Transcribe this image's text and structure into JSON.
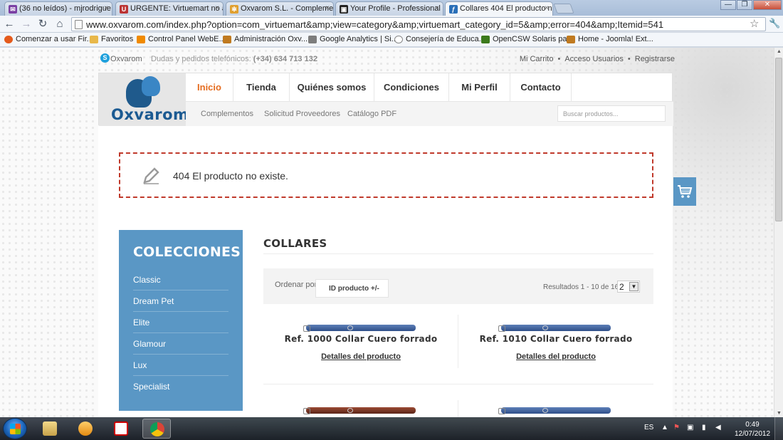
{
  "browser": {
    "tabs": [
      {
        "label": "(36 no leídos) - mjrodrigue",
        "favicon_color": "#7a3fa3",
        "favicon_char": "✉"
      },
      {
        "label": "URGENTE: Virtuemart no a",
        "favicon_color": "#b33",
        "favicon_char": "U"
      },
      {
        "label": "Oxvarom S.L. - Compleme",
        "favicon_color": "#e0a030",
        "favicon_char": "✻"
      },
      {
        "label": "Your Profile - Professional",
        "favicon_color": "#222",
        "favicon_char": "▣"
      },
      {
        "label": "Collares 404 El producto no",
        "favicon_color": "#2a6fb8",
        "favicon_char": "ƒ"
      }
    ],
    "tab_close": "×",
    "window_controls": {
      "minimize": "—",
      "maximize": "❐",
      "close": "✕"
    },
    "url": "www.oxvarom.com/index.php?option=com_virtuemart&amp;view=category&amp;virtuemart_category_id=5&amp;error=404&amp;Itemid=541",
    "nav": {
      "back": "←",
      "forward": "→",
      "reload": "↻",
      "home": "⌂",
      "star": "☆",
      "wrench": "🔧"
    },
    "bookmarks": [
      {
        "label": "Comenzar a usar Fir...",
        "color": "#e45a1c"
      },
      {
        "label": "Favoritos",
        "color": "#e8b84a"
      },
      {
        "label": "Control Panel WebE...",
        "color": "#f08a00"
      },
      {
        "label": "Administración Oxv...",
        "color": "#c07a20"
      },
      {
        "label": "Google Analytics | Si...",
        "color": "#7d7d7d"
      },
      {
        "label": "Consejería de Educa...",
        "color": "#ffffff"
      },
      {
        "label": "OpenCSW Solaris pa...",
        "color": "#3c7a1c"
      },
      {
        "label": "Home - Joomla! Ext...",
        "color": "#c07a20"
      }
    ]
  },
  "page": {
    "topbar": {
      "skype_name": "Oxvarom",
      "phone_label": "Dudas y pedidos telefónicos:",
      "phone": "(+34) 634 713 132",
      "links": [
        "Mi Carrito",
        "Acceso Usuarios",
        "Registrarse"
      ],
      "sep": "•"
    },
    "logo_text": "Oxvarom",
    "main_nav": [
      "Inicio",
      "Tienda",
      "Quiénes somos",
      "Condiciones",
      "Mi Perfil",
      "Contacto"
    ],
    "sub_nav": [
      "Complementos",
      "Solicitud Proveedores",
      "Catálogo PDF"
    ],
    "search_placeholder": "Buscar productos...",
    "error_message": "404 El producto no existe.",
    "sidebar": {
      "title": "COLECCIONES",
      "items": [
        "Classic",
        "Dream Pet",
        "Elite",
        "Glamour",
        "Lux",
        "Specialist"
      ]
    },
    "category": {
      "title": "COLLARES",
      "order_label": "Ordenar por",
      "order_value": "ID producto +/-",
      "results": "Resultados 1 - 10 de 165",
      "per_page_value": "2",
      "per_page_arrow": "▼"
    },
    "products": [
      {
        "name": "Ref. 1000 Collar Cuero forrado",
        "details": "Detalles del producto",
        "collar": "blue"
      },
      {
        "name": "Ref. 1010 Collar Cuero forrado",
        "details": "Detalles del producto",
        "collar": "blue"
      },
      {
        "name": "",
        "details": "",
        "collar": "brown"
      },
      {
        "name": "",
        "details": "",
        "collar": "blue"
      }
    ]
  },
  "taskbar": {
    "lang": "ES",
    "time": "0:49",
    "date": "12/07/2012"
  }
}
